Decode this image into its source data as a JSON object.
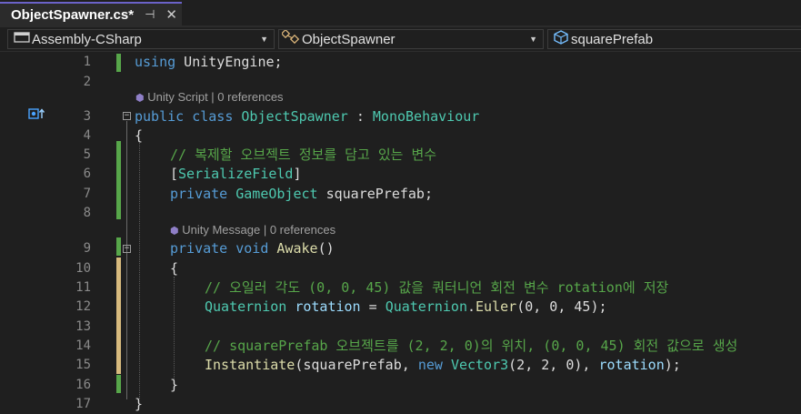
{
  "tab": {
    "title": "ObjectSpawner.cs*",
    "pin_glyph": "⊣",
    "close_glyph": "✕"
  },
  "nav": {
    "project": "Assembly-CSharp",
    "class": "ObjectSpawner",
    "member": "squarePrefab"
  },
  "codelens": {
    "class_lens": "Unity Script | 0 references",
    "method_lens": "Unity Message | 0 references"
  },
  "line_numbers": [
    "1",
    "2",
    "3",
    "4",
    "5",
    "6",
    "7",
    "8",
    "9",
    "10",
    "11",
    "12",
    "13",
    "14",
    "15",
    "16",
    "17"
  ],
  "code": {
    "l1_kw": "using",
    "l1_rest": " UnityEngine;",
    "l3_kw": "public class",
    "l3_name": "ObjectSpawner",
    "l3_colon": " : ",
    "l3_base": "MonoBehaviour",
    "l4": "{",
    "l5_comment": "// 복제할 오브젝트 정보를 담고 있는 변수",
    "l6_open": "[",
    "l6_attr": "SerializeField",
    "l6_close": "]",
    "l7_kw": "private",
    "l7_type": "GameObject",
    "l7_rest": " squarePrefab;",
    "l9_kw": "private void",
    "l9_fn": "Awake",
    "l9_rest": "()",
    "l10": "{",
    "l11_comment": "// 오일러 각도 (0, 0, 45) 값을 쿼터니언 회전 변수 rotation에 저장",
    "l12_type": "Quaternion",
    "l12_var": "rotation",
    "l12_eq": " = ",
    "l12_type2": "Quaternion",
    "l12_dot": ".",
    "l12_fn": "Euler",
    "l12_args": "(0, 0, 45);",
    "l14_comment": "// squarePrefab 오브젝트를 (2, 2, 0)의 위치, (0, 0, 45) 회전 값으로 생성",
    "l15_fn": "Instantiate",
    "l15_a": "(squarePrefab, ",
    "l15_new": "new",
    "l15_type": "Vector3",
    "l15_b": "(2, 2, 0), ",
    "l15_var": "rotation",
    "l15_c": ");",
    "l16": "}",
    "l17": "}"
  },
  "colors": {
    "keyword": "#569cd6",
    "type": "#4ec9b0",
    "comment": "#57a64a",
    "method": "#dcdcaa",
    "variable": "#9cdcfe",
    "tab_accent": "#6b62c9"
  },
  "icons": {
    "tab_pin": "pin-icon",
    "tab_close": "close-icon",
    "project_dropdown": "chevron-down-icon",
    "class_icon": "class-icon",
    "member_icon": "field-icon",
    "implements_icon": "implements-icon"
  }
}
